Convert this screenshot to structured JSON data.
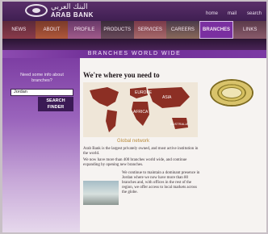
{
  "header": {
    "brand_arabic": "البنك العربي",
    "brand": "ARAB BANK",
    "util_links": [
      "home",
      "mail",
      "search"
    ]
  },
  "nav": {
    "items": [
      "NEWS",
      "ABOUT",
      "PROFILE",
      "PRODUCTS",
      "SERVICES",
      "CAREERS",
      "BRANCHES",
      "LINKS"
    ],
    "active_index": 6
  },
  "subbar": {
    "label": "BRANCHES WORLD WIDE"
  },
  "left_panel": {
    "question": "Need some info about branches?",
    "select_value": "Jordan",
    "button_label": "SEARCH FINDER"
  },
  "main": {
    "heading": "We're where you need to",
    "map_labels": [
      "EUROPE",
      "ASIA",
      "AFRICA",
      "AUSTRALIA"
    ],
    "map_caption": "Global network",
    "para1": "Arab Bank is the largest privately owned, and most active institution in the world.",
    "para2": "We now have more than 400 branches world wide, and continue expanding by opening new branches.",
    "para3": "We continue to maintain a dominant presence in Jordan where we now have more than 80 branches and, with offices in the rest of the region, we offer access to local markets across the globe."
  }
}
